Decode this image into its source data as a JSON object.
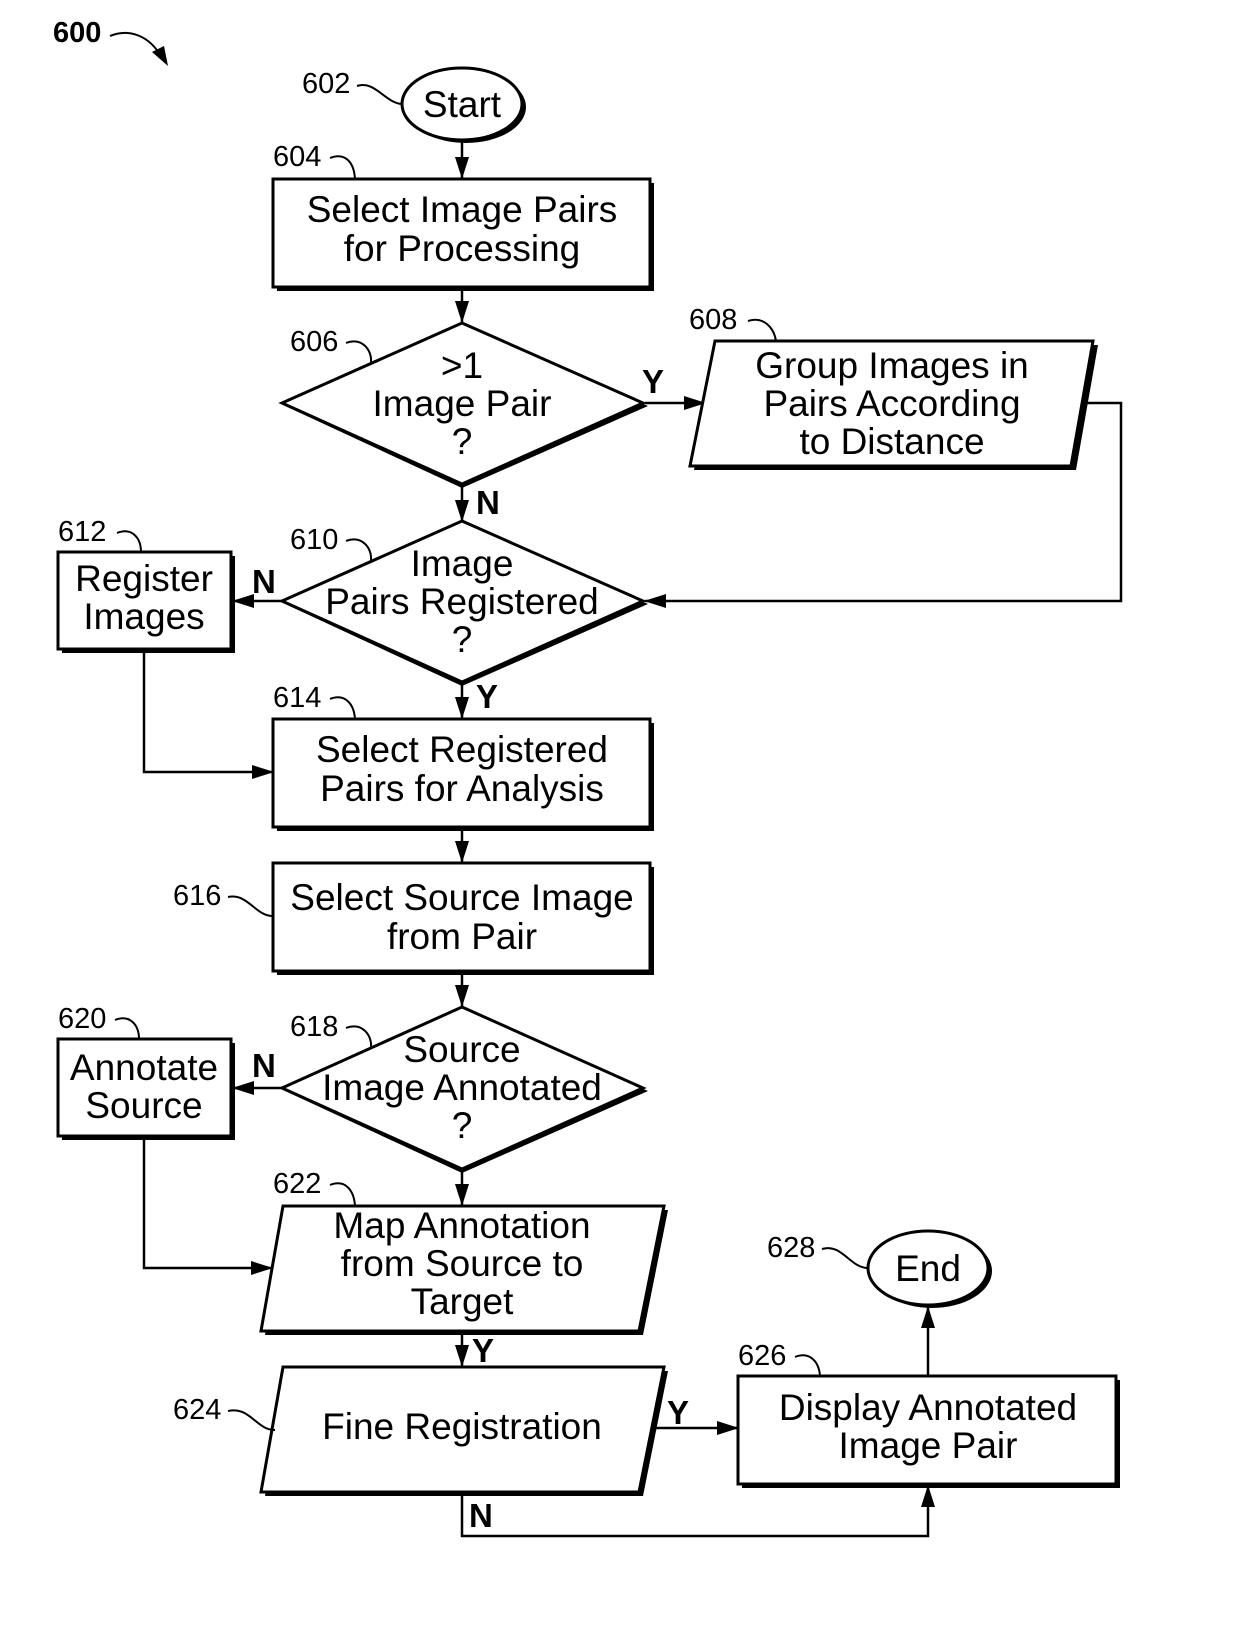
{
  "figure": {
    "label": "600"
  },
  "nodes": {
    "start": {
      "ref": "602",
      "lines": [
        "Start"
      ]
    },
    "select_pairs": {
      "ref": "604",
      "lines": [
        "Select Image Pairs",
        "for Processing"
      ]
    },
    "more_than_one": {
      "ref": "606",
      "lines": [
        ">1",
        "Image Pair",
        "?"
      ]
    },
    "group_images": {
      "ref": "608",
      "lines": [
        "Group Images in",
        "Pairs According",
        "to Distance"
      ]
    },
    "pairs_registered": {
      "ref": "610",
      "lines": [
        "Image",
        "Pairs Registered",
        "?"
      ]
    },
    "register_images": {
      "ref": "612",
      "lines": [
        "Register",
        "Images"
      ]
    },
    "select_registered": {
      "ref": "614",
      "lines": [
        "Select Registered",
        "Pairs for Analysis"
      ]
    },
    "select_source": {
      "ref": "616",
      "lines": [
        "Select Source Image",
        "from Pair"
      ]
    },
    "source_annotated": {
      "ref": "618",
      "lines": [
        "Source",
        "Image Annotated",
        "?"
      ]
    },
    "annotate_source": {
      "ref": "620",
      "lines": [
        "Annotate",
        "Source"
      ]
    },
    "map_annotation": {
      "ref": "622",
      "lines": [
        "Map Annotation",
        "from Source to",
        "Target"
      ]
    },
    "fine_registration": {
      "ref": "624",
      "lines": [
        "Fine Registration"
      ]
    },
    "display_pair": {
      "ref": "626",
      "lines": [
        "Display Annotated",
        "Image Pair"
      ]
    },
    "end": {
      "ref": "628",
      "lines": [
        "End"
      ]
    }
  },
  "edge_labels": {
    "d606_yes": "Y",
    "d606_no": "N",
    "d610_no": "N",
    "d610_yes": "Y",
    "d618_no": "N",
    "p622_yes": "Y",
    "p624_yes": "Y",
    "p624_no": "N"
  }
}
